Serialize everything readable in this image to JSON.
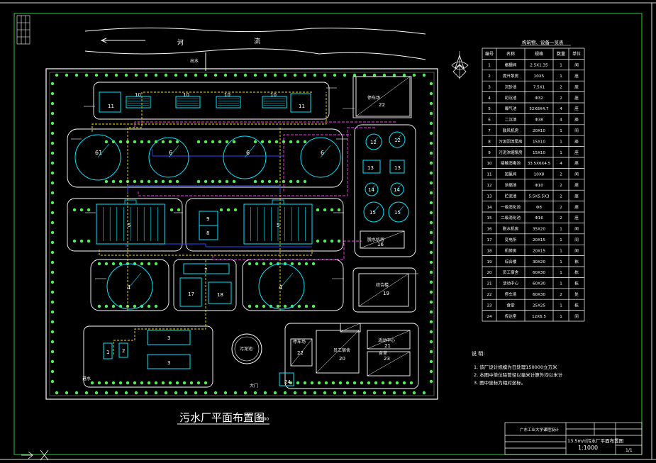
{
  "drawing": {
    "title": "污水厂平面布置图",
    "scale": "1:1000",
    "river_label_1": "河",
    "river_label_2": "流",
    "gate_label": "大门",
    "pond_label": "污泥池",
    "inlet_label": "进水",
    "outlet_label": "出水"
  },
  "units": [
    {
      "id": "u1",
      "label": "11"
    },
    {
      "id": "u2",
      "label": "10"
    },
    {
      "id": "u3",
      "label": "10"
    },
    {
      "id": "u4",
      "label": "10"
    },
    {
      "id": "u5",
      "label": "10"
    },
    {
      "id": "u6",
      "label": "11"
    },
    {
      "id": "u7",
      "label": "22",
      "caption": "停车场"
    },
    {
      "id": "u8",
      "label": "61"
    },
    {
      "id": "u9",
      "label": "6"
    },
    {
      "id": "u10",
      "label": "6"
    },
    {
      "id": "u11",
      "label": "6"
    },
    {
      "id": "u12",
      "label": "12"
    },
    {
      "id": "u13",
      "label": "12"
    },
    {
      "id": "u14",
      "label": "13"
    },
    {
      "id": "u15",
      "label": "13"
    },
    {
      "id": "u16",
      "label": "14"
    },
    {
      "id": "u17",
      "label": "14"
    },
    {
      "id": "u18",
      "label": "15"
    },
    {
      "id": "u19",
      "label": "15"
    },
    {
      "id": "u20",
      "label": "16",
      "caption": "脱水机房"
    },
    {
      "id": "u21",
      "label": "5"
    },
    {
      "id": "u22",
      "label": "9"
    },
    {
      "id": "u23",
      "label": "8"
    },
    {
      "id": "u24",
      "label": "5"
    },
    {
      "id": "u25",
      "label": "4"
    },
    {
      "id": "u26",
      "label": "7"
    },
    {
      "id": "u27",
      "label": "17"
    },
    {
      "id": "u28",
      "label": "18"
    },
    {
      "id": "u29",
      "label": "4"
    },
    {
      "id": "u30",
      "label": "19",
      "caption": "综合楼"
    },
    {
      "id": "u31",
      "label": "1"
    },
    {
      "id": "u32",
      "label": "2"
    },
    {
      "id": "u33",
      "label": "3"
    },
    {
      "id": "u34",
      "label": "3"
    },
    {
      "id": "u35",
      "label": "22",
      "caption": "停车场"
    },
    {
      "id": "u36",
      "label": "20",
      "caption": "员工宿舍"
    },
    {
      "id": "u37",
      "label": "21",
      "caption": "活动中心"
    },
    {
      "id": "u38",
      "label": "23",
      "caption": "食堂"
    },
    {
      "id": "u39",
      "label": "24"
    }
  ],
  "table": {
    "title": "构筑物、设备一览表",
    "headers": [
      "编号",
      "名称",
      "规格",
      "数量",
      "单位"
    ],
    "rows": [
      [
        "1",
        "格栅间",
        "2.5X1.35",
        "1",
        "间"
      ],
      [
        "2",
        "提升泵房",
        "10X5",
        "1",
        "座"
      ],
      [
        "3",
        "沉砂池",
        "7.5X1",
        "2",
        "座"
      ],
      [
        "4",
        "初沉池",
        "Φ32",
        "2",
        "座"
      ],
      [
        "5",
        "曝气池",
        "52X8X4.7",
        "4",
        "座"
      ],
      [
        "6",
        "二沉池",
        "Φ38",
        "4",
        "座"
      ],
      [
        "7",
        "鼓风机房",
        "20X10",
        "1",
        "间"
      ],
      [
        "8",
        "污泥回流泵房",
        "15X10",
        "1",
        "座"
      ],
      [
        "9",
        "污泥浓缩泵房",
        "15X10",
        "1",
        "座"
      ],
      [
        "10",
        "接触消毒池",
        "33.5X6X4.5",
        "4",
        "座"
      ],
      [
        "11",
        "加氯间",
        "10X8",
        "2",
        "间"
      ],
      [
        "12",
        "浓缩池",
        "Φ10",
        "2",
        "座"
      ],
      [
        "13",
        "贮泥池",
        "5.5X5.5X3",
        "2",
        "座"
      ],
      [
        "14",
        "一级消化池",
        "Φ8",
        "2",
        "座"
      ],
      [
        "15",
        "二级消化池",
        "Φ16",
        "2",
        "座"
      ],
      [
        "16",
        "脱水机房",
        "35X20",
        "1",
        "间"
      ],
      [
        "17",
        "变电所",
        "20X15",
        "1",
        "间"
      ],
      [
        "18",
        "机修房",
        "20X15",
        "1",
        "间"
      ],
      [
        "19",
        "综合楼",
        "30X20",
        "1",
        "栋"
      ],
      [
        "20",
        "员工宿舍",
        "60X30",
        "1",
        "栋"
      ],
      [
        "21",
        "活动中心",
        "60X30",
        "1",
        "栋"
      ],
      [
        "22",
        "停车场",
        "60X30",
        "2",
        "处"
      ],
      [
        "23",
        "食堂",
        "25X25",
        "1",
        "栋"
      ],
      [
        "24",
        "传达室",
        "12X6.5",
        "1",
        "间"
      ]
    ]
  },
  "notes": {
    "title": "说  明:",
    "items": [
      "1. 该厂设计规模为日处理150000立方米",
      "2. 本图中单位除管径以毫米计算外均以米计",
      "3. 图中坐标为相对坐标。"
    ]
  },
  "title_block": {
    "school": "广东工业大学课程设计",
    "drawing_name": "13.5m/d污水厂平面布置图",
    "scale_value": "1:1000",
    "sheet_no": "1/1"
  },
  "colors": {
    "background": "#000000",
    "border": "#33cc33",
    "line": "#ffffff",
    "structure": "#00e5ff",
    "pipe_yellow": "#ffe600",
    "pipe_magenta": "#ff33ff",
    "pipe_blue": "#3344ff",
    "tree": "#55ee55"
  }
}
